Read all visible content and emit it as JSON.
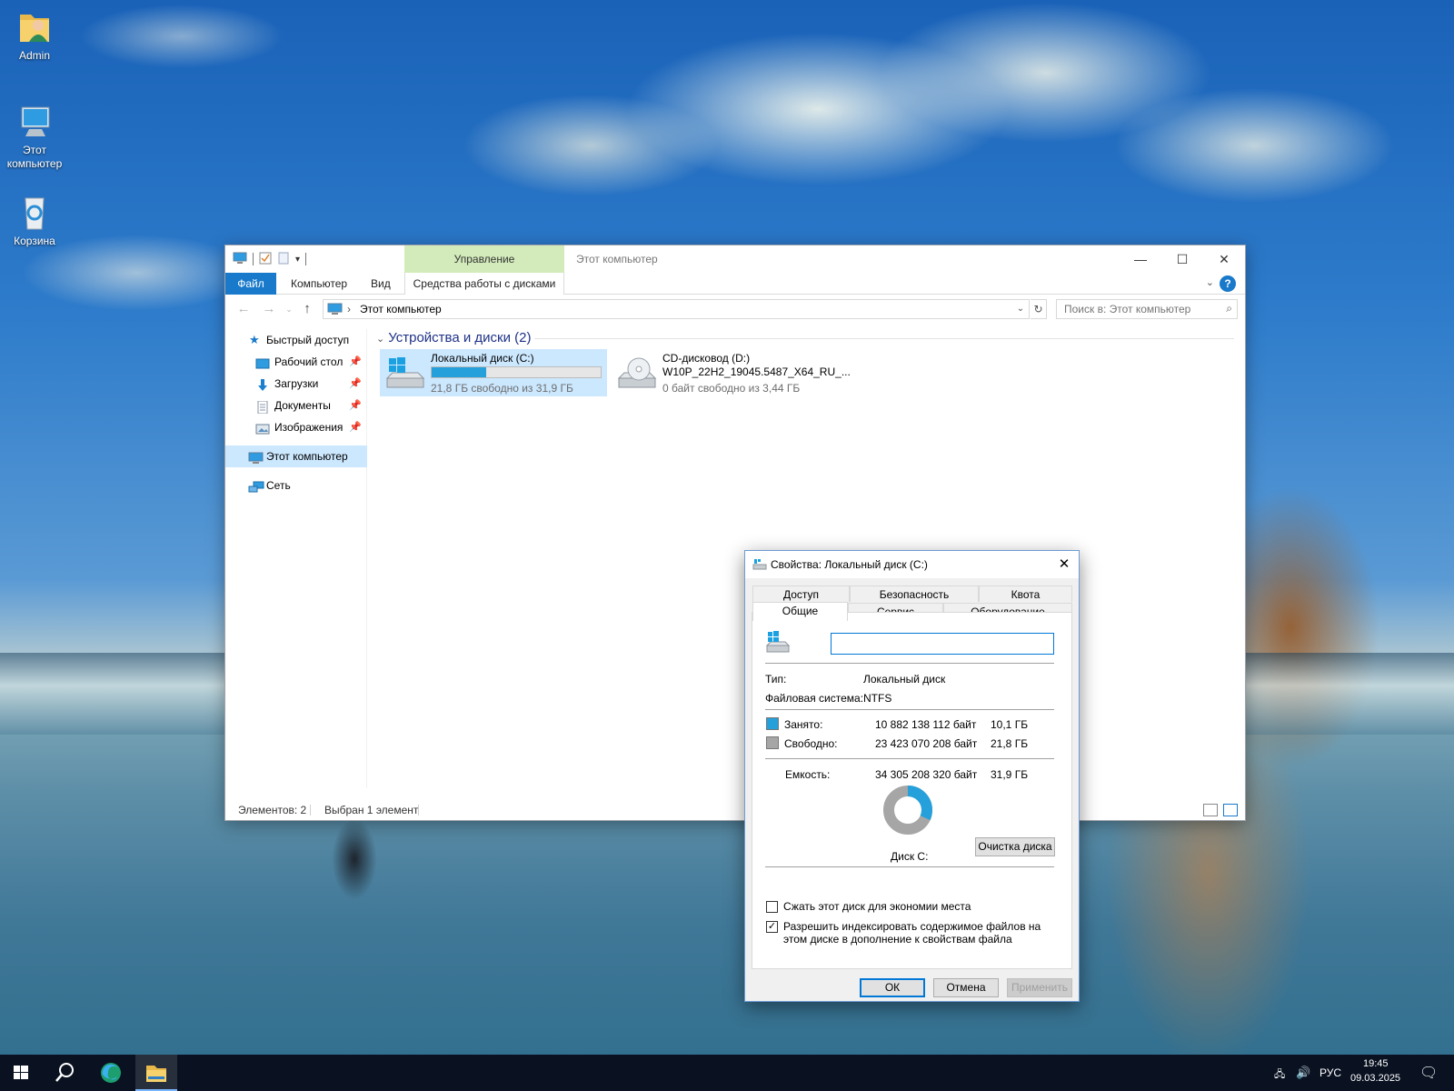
{
  "desktop": {
    "icons": [
      {
        "label": "Admin"
      },
      {
        "label": "Этот компьютер"
      },
      {
        "label": "Корзина"
      }
    ]
  },
  "explorer": {
    "title": "Этот компьютер",
    "context_group": "Управление",
    "tabs": {
      "file": "Файл",
      "computer": "Компьютер",
      "view": "Вид",
      "context_tab": "Средства работы с дисками"
    },
    "address": "Этот компьютер",
    "search_placeholder": "Поиск в: Этот компьютер",
    "nav": {
      "quick_access": "Быстрый доступ",
      "desktop": "Рабочий стол",
      "downloads": "Загрузки",
      "documents": "Документы",
      "pictures": "Изображения",
      "this_pc": "Этот компьютер",
      "network": "Сеть"
    },
    "group_title": "Устройства и диски (2)",
    "drives": [
      {
        "name": "Локальный диск (C:)",
        "free_text": "21,8 ГБ свободно из 31,9 ГБ",
        "used_fraction": 0.32
      },
      {
        "name": "CD-дисковод (D:)",
        "label": "W10P_22H2_19045.5487_X64_RU_...",
        "free_text": "0 байт свободно из 3,44 ГБ"
      }
    ],
    "status": {
      "items": "Элементов: 2",
      "selected": "Выбран 1 элемент"
    }
  },
  "dialog": {
    "title": "Свойства: Локальный диск (C:)",
    "tabs": {
      "access": "Доступ",
      "security": "Безопасность",
      "quota": "Квота",
      "general": "Общие",
      "service": "Сервис",
      "hardware": "Оборудование"
    },
    "name_value": "",
    "type_label": "Тип:",
    "type_value": "Локальный диск",
    "fs_label": "Файловая система:",
    "fs_value": "NTFS",
    "used_label": "Занято:",
    "used_bytes": "10 882 138 112 байт",
    "used_gb": "10,1 ГБ",
    "free_label": "Свободно:",
    "free_bytes": "23 423 070 208 байт",
    "free_gb": "21,8 ГБ",
    "capacity_label": "Емкость:",
    "capacity_bytes": "34 305 208 320 байт",
    "capacity_gb": "31,9 ГБ",
    "disk_label": "Диск C:",
    "cleanup_button": "Очистка диска",
    "compress_label": "Сжать этот диск для экономии места",
    "compress_checked": false,
    "index_label": "Разрешить индексировать содержимое файлов на этом диске в дополнение к свойствам файла",
    "index_checked": true,
    "ok": "ОК",
    "cancel": "Отмена",
    "apply": "Применить",
    "used_fraction": 0.317,
    "colors": {
      "used": "#26a0da",
      "free": "#a6a6a6"
    }
  },
  "taskbar": {
    "lang": "РУС",
    "time": "19:45",
    "date": "09.03.2025"
  }
}
